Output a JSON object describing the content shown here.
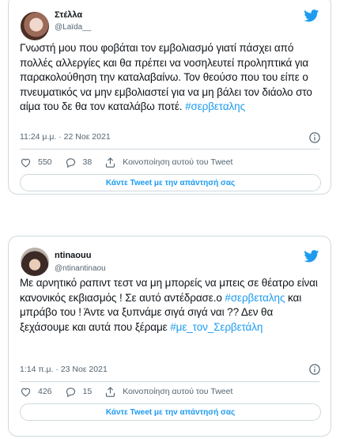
{
  "tweets": [
    {
      "name": "Στέλλα",
      "handle": "@Laïda__",
      "text_before": "Γνωστή μου που φοβάται τον εμβολιασμό γιατί πάσχει από πολλές αλλεργίες και θα πρέπει να νοσηλευτεί προληπτικά για παρακολούθηση την καταλαβαίνω. Τον θεούσο που του είπε ο πνευματικός να μην εμβολιαστεί για να μη βάλει τον διάολο στο αίμα του δε θα τον καταλάβω ποτέ. ",
      "hashtag": "#σερβεταλης",
      "timestamp": "11:24 μ.μ. · 22 Νοε 2021",
      "likes": "550",
      "replies": "38",
      "share_label": "Κοινοποίηση αυτού του Tweet",
      "reply_button": "Κάντε Tweet με την απάντησή σας"
    },
    {
      "name": "ntinaouu",
      "handle": "@ntinantinaou",
      "text_part1": "Με αρνητικό ραπιντ τεστ να μη μπορείς να μπεις σε θέατρο είναι κανονικός εκβιασμός !  Σε αυτό αντέδρασε.ο ",
      "hashtag1": "#σερβεταλης",
      "text_part2": " και μπράβο του ! Άντε να ξυπνάμε σιγά σιγά ναι ?? Δεν θα ξεχάσουμε και αυτά που ξέραμε ",
      "hashtag2": "#με_τον_Σερβετάλη",
      "timestamp": "1:14 π.μ. · 23 Νοε 2021",
      "likes": "426",
      "replies": "15",
      "share_label": "Κοινοποίηση αυτού του Tweet",
      "reply_button": "Κάντε Tweet με την απάντησή σας"
    }
  ],
  "colors": {
    "accent": "#1d9bf0",
    "text": "#0f1419",
    "muted": "#536471",
    "border": "#cfd9de"
  },
  "icons": [
    "twitter-bird-icon",
    "info-icon",
    "heart-icon",
    "reply-icon",
    "share-icon"
  ]
}
